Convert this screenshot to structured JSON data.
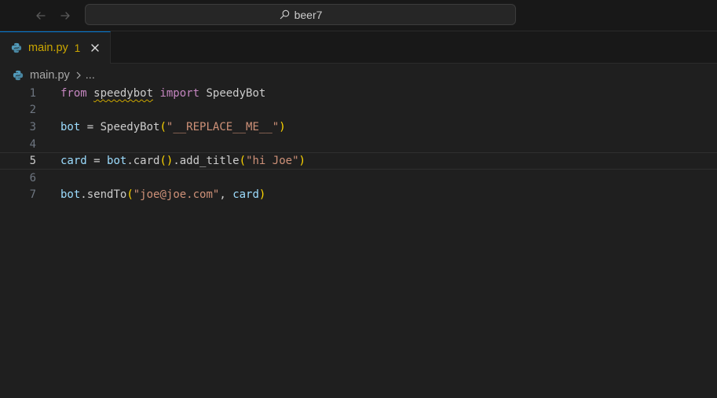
{
  "titlebar": {
    "search_text": "beer7"
  },
  "tabs": [
    {
      "label": "main.py",
      "problem_count": "1"
    }
  ],
  "breadcrumb": {
    "file": "main.py",
    "more": "..."
  },
  "editor": {
    "active_line": 5,
    "line_numbers": [
      "1",
      "2",
      "3",
      "4",
      "5",
      "6",
      "7"
    ],
    "lines": [
      [
        {
          "t": "from",
          "c": "kw"
        },
        {
          "t": " ",
          "c": "plain"
        },
        {
          "t": "speedybot",
          "c": "plain squiggle"
        },
        {
          "t": " ",
          "c": "plain"
        },
        {
          "t": "import",
          "c": "kw"
        },
        {
          "t": " SpeedyBot",
          "c": "plain"
        }
      ],
      [],
      [
        {
          "t": "bot",
          "c": "var"
        },
        {
          "t": " = SpeedyBot",
          "c": "plain"
        },
        {
          "t": "(",
          "c": "br1"
        },
        {
          "t": "\"__REPLACE__ME__\"",
          "c": "str"
        },
        {
          "t": ")",
          "c": "br1"
        }
      ],
      [],
      [
        {
          "t": "card",
          "c": "var"
        },
        {
          "t": " = ",
          "c": "plain"
        },
        {
          "t": "bot",
          "c": "var"
        },
        {
          "t": ".card",
          "c": "plain"
        },
        {
          "t": "()",
          "c": "br1"
        },
        {
          "t": ".add_title",
          "c": "plain"
        },
        {
          "t": "(",
          "c": "br1"
        },
        {
          "t": "\"hi Joe\"",
          "c": "str"
        },
        {
          "t": ")",
          "c": "br1"
        }
      ],
      [],
      [
        {
          "t": "bot",
          "c": "var"
        },
        {
          "t": ".sendTo",
          "c": "plain"
        },
        {
          "t": "(",
          "c": "br1"
        },
        {
          "t": "\"joe@joe.com\"",
          "c": "str"
        },
        {
          "t": ", ",
          "c": "plain"
        },
        {
          "t": "card",
          "c": "var"
        },
        {
          "t": ")",
          "c": "br1"
        }
      ]
    ]
  },
  "icons": {
    "back": "arrow-left-icon",
    "forward": "arrow-right-icon",
    "search": "search-icon",
    "file": "python-file-icon",
    "close": "close-icon",
    "separator": "chevron-right-icon"
  },
  "colors": {
    "background": "#1f1f1f",
    "chrome": "#181818",
    "accent": "#0078d4",
    "warning": "#cca700",
    "keyword": "#c586c0",
    "variable": "#9cdcfe",
    "string": "#ce9178",
    "bracket": "#ffd700"
  }
}
